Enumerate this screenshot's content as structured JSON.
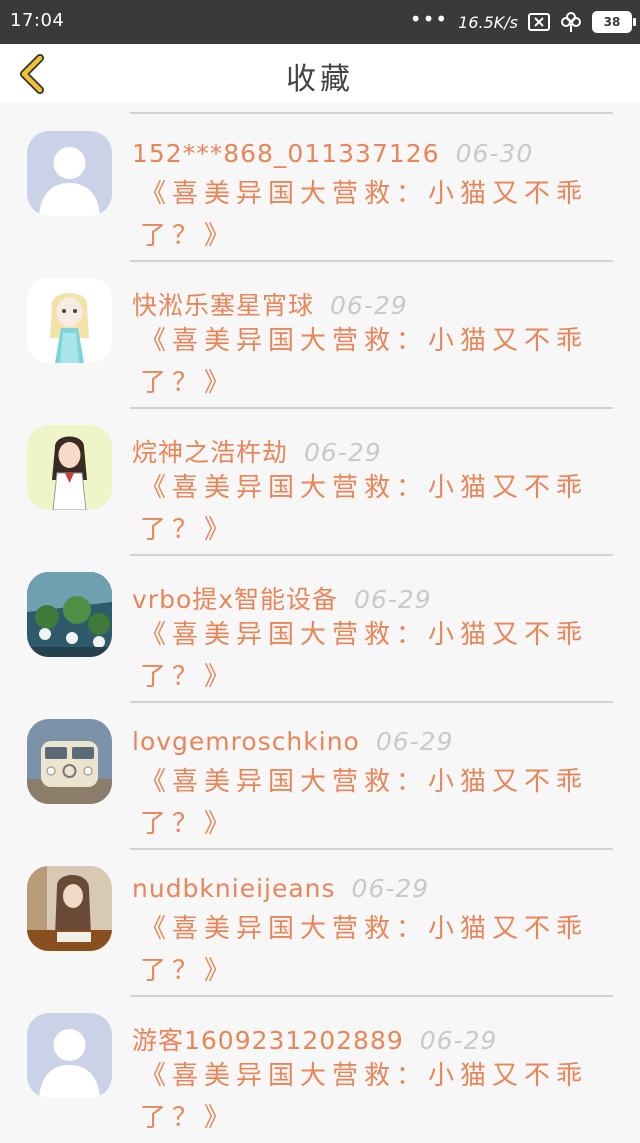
{
  "status_bar": {
    "time": "17:04",
    "signal": "•••",
    "speed": "16.5K/s",
    "battery": "38",
    "icons": [
      "close-box-icon",
      "clover-icon",
      "battery-icon"
    ]
  },
  "header": {
    "title": "收藏",
    "back_icon": "chevron-left-icon"
  },
  "colors": {
    "accent": "#e8865a",
    "date": "#c9c9c9",
    "back": "#f2c230"
  },
  "items": [
    {
      "name": "152***868_011337126",
      "date": "06-30",
      "content": "《喜美异国大营救：小猫又不乖了？》",
      "avatar": "default-avatar"
    },
    {
      "name": "快淞乐塞星宵球",
      "date": "06-29",
      "content": "《喜美异国大营救：小猫又不乖了？》",
      "avatar": "princess-avatar"
    },
    {
      "name": "烷神之浩杵劫",
      "date": "06-29",
      "content": "《喜美异国大营救：小猫又不乖了？》",
      "avatar": "girl-avatar"
    },
    {
      "name": "vrbo提x智能设备",
      "date": "06-29",
      "content": "《喜美异国大营救：小猫又不乖了？》",
      "avatar": "plants-avatar"
    },
    {
      "name": "lovgemroschkino",
      "date": "06-29",
      "content": "《喜美异国大营救：小猫又不乖了？》",
      "avatar": "van-avatar"
    },
    {
      "name": "nudbknieijeans",
      "date": "06-29",
      "content": "《喜美异国大营救：小猫又不乖了？》",
      "avatar": "photo-avatar"
    },
    {
      "name": "游客1609231202889",
      "date": "06-29",
      "content": "《喜美异国大营救：小猫又不乖了？》",
      "avatar": "default-avatar"
    }
  ]
}
